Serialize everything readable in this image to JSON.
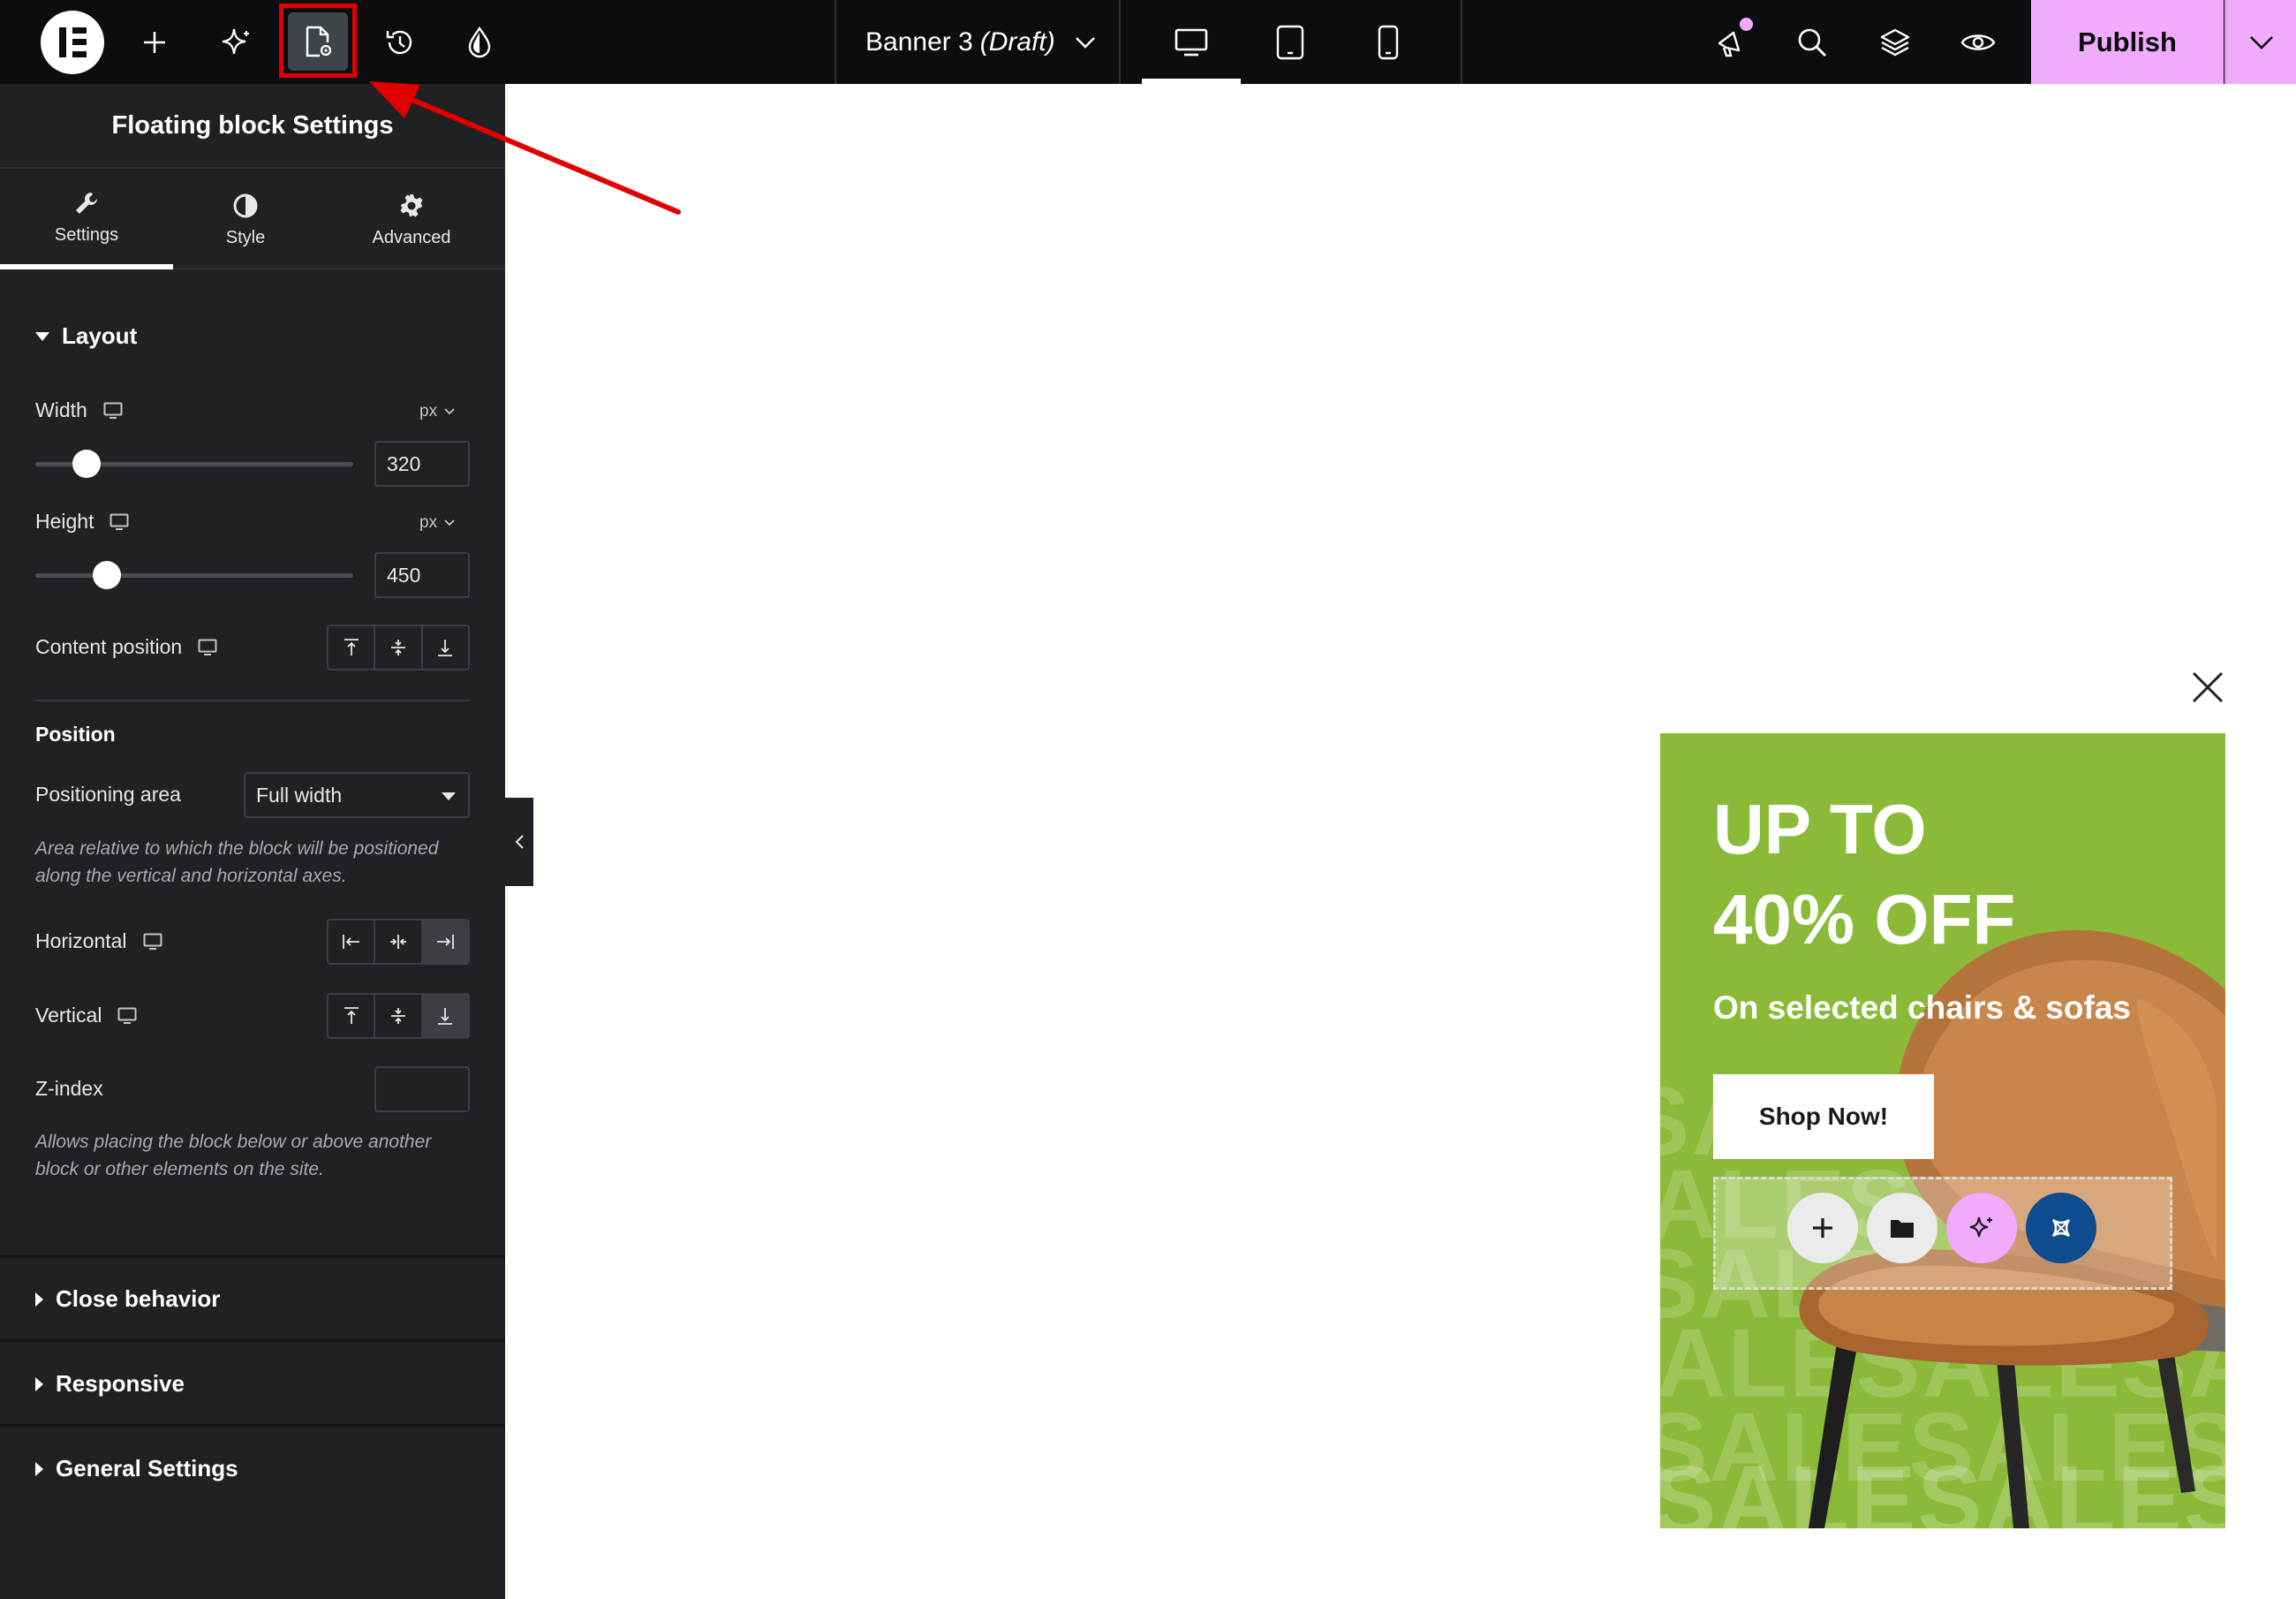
{
  "topbar": {
    "document_name": "Banner 3",
    "document_status": "(Draft)",
    "publish_label": "Publish"
  },
  "panel": {
    "title": "Floating block Settings",
    "tabs": [
      {
        "label": "Settings"
      },
      {
        "label": "Style"
      },
      {
        "label": "Advanced"
      }
    ],
    "layout": {
      "heading": "Layout",
      "width_label": "Width",
      "width_unit": "px",
      "width_value": "320",
      "height_label": "Height",
      "height_unit": "px",
      "height_value": "450",
      "content_position_label": "Content position"
    },
    "position": {
      "heading": "Position",
      "area_label": "Positioning area",
      "area_value": "Full width",
      "area_help": "Area relative to which the block will be positioned along the vertical and horizontal axes.",
      "horizontal_label": "Horizontal",
      "vertical_label": "Vertical",
      "zindex_label": "Z-index",
      "zindex_value": "",
      "zindex_help": "Allows placing the block below or above another block or other elements on the site."
    },
    "sections": [
      {
        "label": "Close behavior"
      },
      {
        "label": "Responsive"
      },
      {
        "label": "General Settings"
      }
    ]
  },
  "banner": {
    "headline_line1": "UP TO",
    "headline_line2": "40% OFF",
    "subheadline": "On selected chairs & sofas",
    "button_label": "Shop Now!",
    "background_word": "SALE"
  },
  "colors": {
    "topbar_bg": "#0c0d0e",
    "panel_bg": "#1f2124",
    "publish_bg": "#f0abfc",
    "banner_bg": "#8aba38",
    "highlight": "#e00000",
    "ai_button": "#f0abfc",
    "template_button": "#0e4b8f"
  }
}
